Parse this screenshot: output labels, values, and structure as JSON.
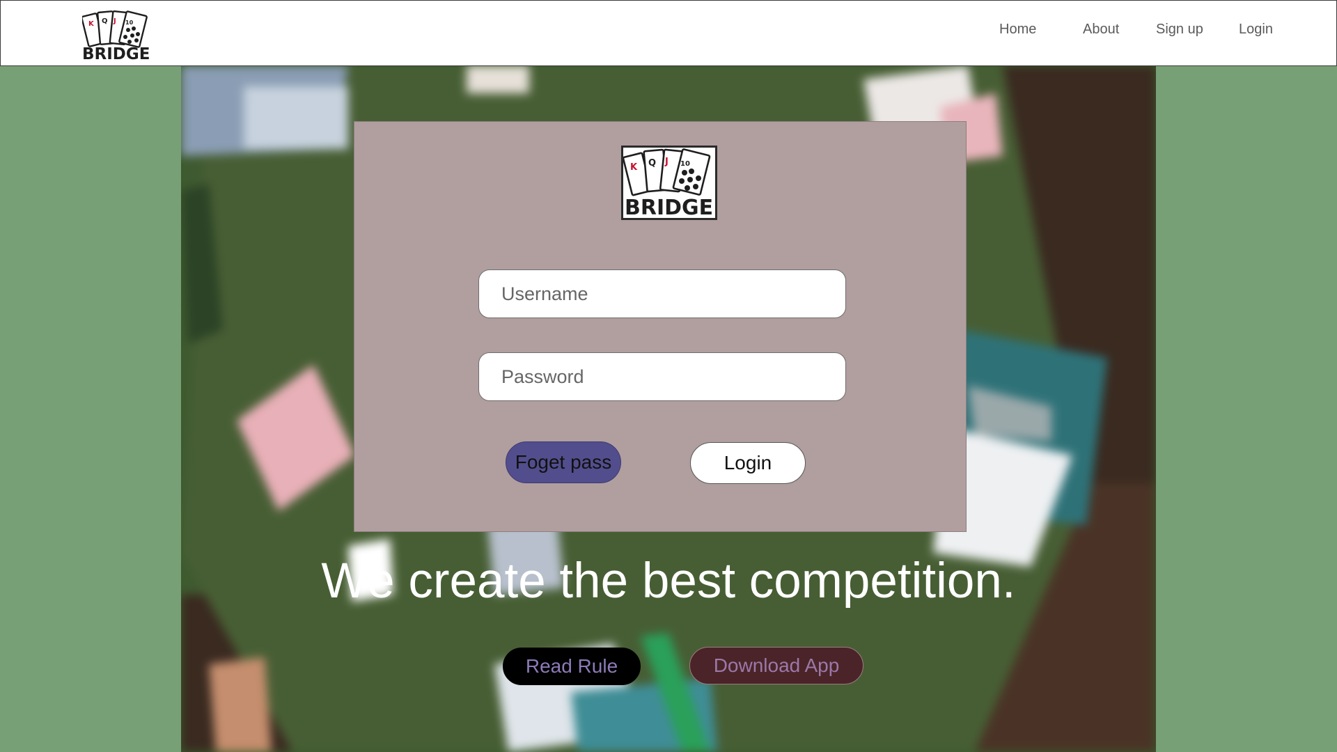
{
  "brand": {
    "logo_text": "BRIDGE"
  },
  "nav": {
    "items": [
      {
        "label": "Home"
      },
      {
        "label": "About"
      },
      {
        "label": "Sign up"
      },
      {
        "label": "Login"
      }
    ]
  },
  "login_form": {
    "username_placeholder": "Username",
    "password_placeholder": "Password",
    "forget_label": "Foget pass",
    "login_label": "Login"
  },
  "hero": {
    "headline": "We create the best competition.",
    "read_rule_label": "Read Rule",
    "download_label": "Download App"
  },
  "colors": {
    "page_bg": "#78a076",
    "panel_bg": "#b19e9f",
    "forget_btn": "#524e8d",
    "download_btn": "#4a2428",
    "read_btn": "#000000"
  }
}
